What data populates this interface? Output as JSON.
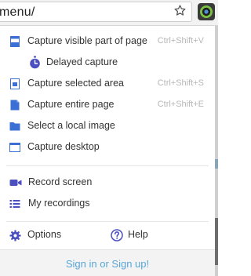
{
  "browser": {
    "address_text": "menu/",
    "star_icon": "bookmark-star-icon",
    "extension_icon": "awesome-screenshot-extension-icon"
  },
  "menu": {
    "capture_visible": {
      "label": "Capture visible part of page",
      "shortcut": "Ctrl+Shift+V",
      "icon": "page-visible-icon"
    },
    "delayed": {
      "label": "Delayed capture",
      "icon": "timer-icon"
    },
    "capture_area": {
      "label": "Capture selected area",
      "shortcut": "Ctrl+Shift+S",
      "icon": "selection-icon"
    },
    "capture_entire": {
      "label": "Capture entire page",
      "shortcut": "Ctrl+Shift+E",
      "icon": "full-page-icon"
    },
    "local_image": {
      "label": "Select a local image",
      "icon": "folder-icon"
    },
    "capture_desktop": {
      "label": "Capture desktop",
      "icon": "desktop-window-icon"
    },
    "record_screen": {
      "label": "Record screen",
      "icon": "video-camera-icon"
    },
    "my_recordings": {
      "label": "My recordings",
      "icon": "list-icon"
    },
    "options": {
      "label": "Options",
      "icon": "gear-icon"
    },
    "help": {
      "label": "Help",
      "icon": "help-circle-icon"
    }
  },
  "footer": {
    "link_label": "Sign in or Sign up!"
  },
  "colors": {
    "icon_blue": "#3b6fd6",
    "icon_purple": "#4b4fbf",
    "link_blue": "#59a6d6",
    "shortcut_gray": "#b7b7b7"
  }
}
